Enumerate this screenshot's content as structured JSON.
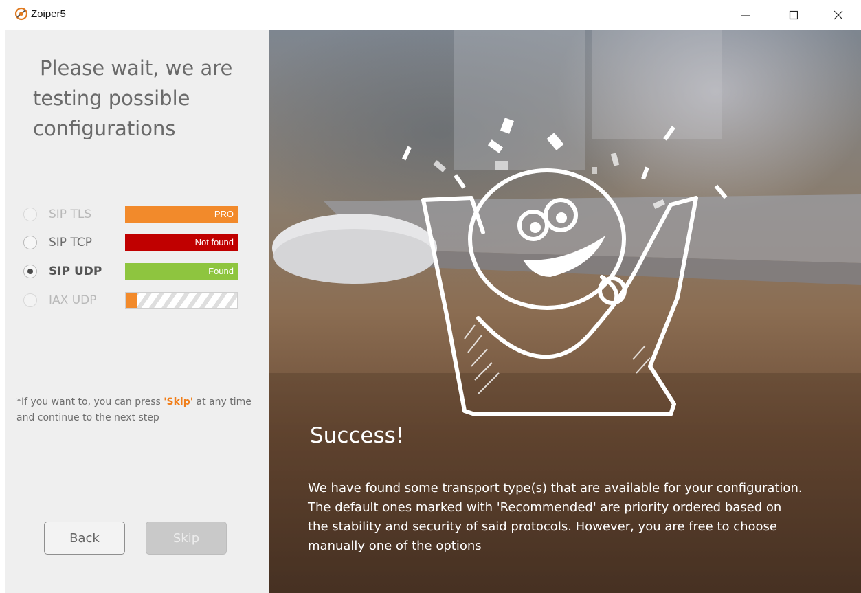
{
  "window": {
    "title": "Zoiper5",
    "icon": "zoiper-logo-icon"
  },
  "left": {
    "heading": {
      "line1": "Please wait, we are",
      "line2": "testing possible",
      "line3": "configurations"
    },
    "options": [
      {
        "label": "SIP TLS",
        "status": "PRO",
        "state": "disabled"
      },
      {
        "label": "SIP TCP",
        "status": "Not found",
        "state": "unchecked"
      },
      {
        "label": "SIP UDP",
        "status": "Found",
        "state": "checked"
      },
      {
        "label": "IAX UDP",
        "status": "",
        "state": "testing",
        "progress": 0.1
      }
    ],
    "note": {
      "before": "*If you want to, you can press ",
      "skip_word": "'Skip'",
      "after": " at any time and continue to the next step"
    },
    "buttons": {
      "back": "Back",
      "skip": "Skip"
    }
  },
  "right": {
    "title": "Success!",
    "paragraph1": " We have found some transport type(s) that are available for your configuration.",
    "paragraph2": "The default ones marked with 'Recommended' are priority ordered based on the stability and security of said protocols. However, you are free to choose manually one of the options"
  },
  "colors": {
    "pro": "#f28a2b",
    "not_found": "#c00000",
    "found": "#8ec53f",
    "skip_highlight": "#f07f1c"
  }
}
